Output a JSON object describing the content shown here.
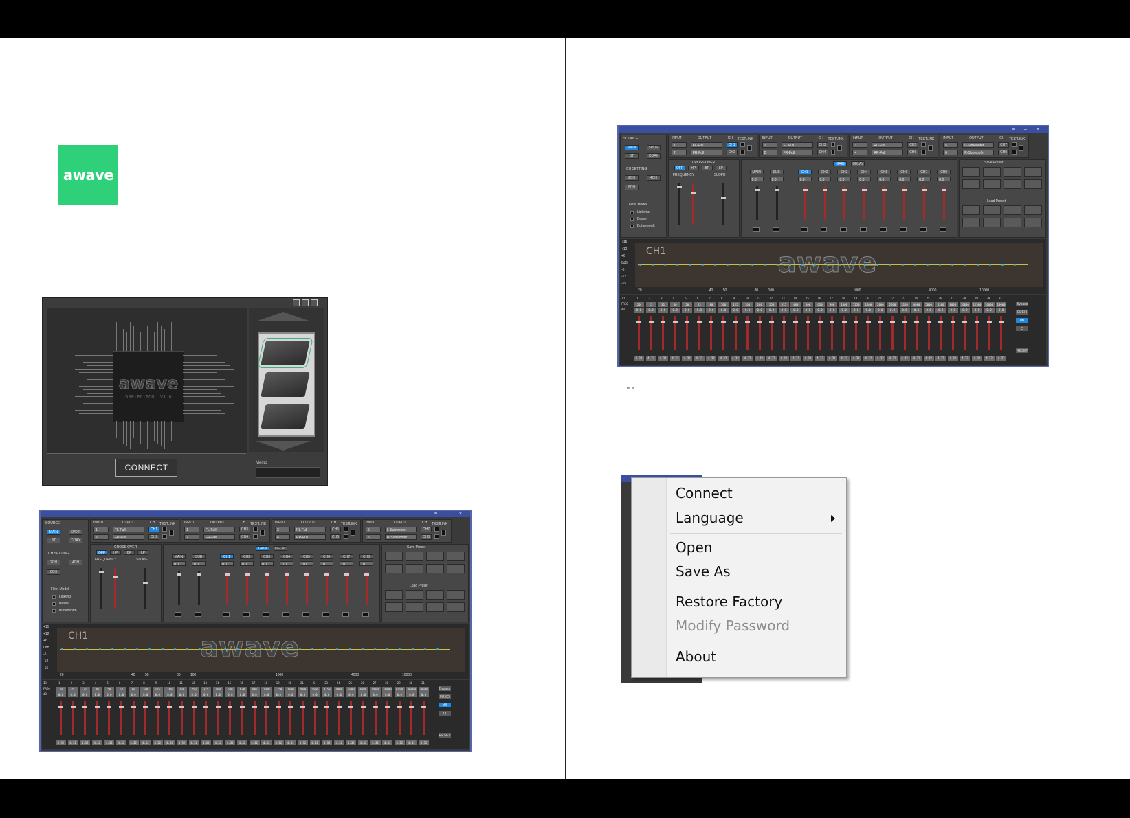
{
  "logo": {
    "text": "awave",
    "color": "#2fd07a"
  },
  "connect_window": {
    "chip_brand": "awave",
    "chip_model": "DSP-PC-TOOL V1.0",
    "connect_label": "CONNECT",
    "memo_label": "Memo"
  },
  "dsp_window": {
    "source_label": "SOURCE",
    "source_buttons": [
      "MAIN",
      "SPDIF",
      "BT",
      "COAX"
    ],
    "ch_setting_label": "CH SETTING",
    "ch_setting_buttons": [
      "2CH",
      "4CH",
      "8CH"
    ],
    "filter_model_label": "Filter Model",
    "filter_models": [
      "Linkwitz",
      "Bessel",
      "Butterworth"
    ],
    "input_label": "INPUT",
    "output_label": "OUTPUT",
    "ch_label": "CH",
    "test_label": "TEST",
    "link_label": "LINK",
    "routing": [
      {
        "in": [
          "1",
          "2"
        ],
        "out": [
          "FL-Full",
          "FR-Full"
        ],
        "ch": [
          "CH1",
          "CH2"
        ]
      },
      {
        "in": [
          "1",
          "2"
        ],
        "out": [
          "FL-Full",
          "FR-Full"
        ],
        "ch": [
          "CH3",
          "CH4"
        ]
      },
      {
        "in": [
          "3",
          "4"
        ],
        "out": [
          "RL-Full",
          "RR-Full"
        ],
        "ch": [
          "CH5",
          "CH6"
        ]
      },
      {
        "in": [
          "5",
          "6"
        ],
        "out": [
          "L-Subwoofer",
          "R-Subwoofer"
        ],
        "ch": [
          "CH7",
          "CH8"
        ]
      }
    ],
    "crossover_label": "CROSS OVER",
    "crossover_buttons": [
      "OFF",
      "HP",
      "BP",
      "LP"
    ],
    "frequency_label": "FREQUENCY",
    "slope_label": "SLOPE",
    "gain_label": "GAIN",
    "delay_label": "DELAY",
    "channel_buttons": [
      "MAIN",
      "SUB",
      "CH1",
      "CH2",
      "CH3",
      "CH4",
      "CH5",
      "CH6",
      "CH7",
      "CH8"
    ],
    "channel_values": [
      "0.0",
      "0.0",
      "0.0",
      "0.0",
      "0.0",
      "0.0",
      "0.0",
      "0.0",
      "0.0",
      "0.0"
    ],
    "save_preset_label": "Save Preset",
    "load_preset_label": "Load Preset",
    "graph_channel": "CH1",
    "graph_logo": "awave",
    "graph_y_ticks": [
      "+15",
      "+12",
      "+6",
      "0dB",
      "-6",
      "-12",
      "-15"
    ],
    "graph_x_ticks": [
      "20",
      "40",
      "50",
      "80",
      "100",
      "1000",
      "4000",
      "10000"
    ],
    "eq_row_labels": [
      "ID",
      "FREQ",
      "dB"
    ],
    "eq_bands": [
      "1",
      "2",
      "3",
      "4",
      "5",
      "6",
      "7",
      "8",
      "9",
      "10",
      "11",
      "12",
      "13",
      "14",
      "15",
      "16",
      "17",
      "18",
      "19",
      "20",
      "21",
      "22",
      "23",
      "24",
      "25",
      "26",
      "27",
      "28",
      "29",
      "30",
      "31"
    ],
    "eq_freqs": [
      "20",
      "25",
      "31",
      "40",
      "50",
      "63",
      "80",
      "100",
      "125",
      "160",
      "200",
      "250",
      "315",
      "400",
      "500",
      "630",
      "800",
      "1000",
      "1250",
      "1600",
      "2000",
      "2500",
      "3150",
      "4000",
      "5000",
      "6300",
      "8000",
      "10000",
      "12500",
      "16000",
      "20000"
    ],
    "eq_db": "0.0",
    "eq_q": "4.32",
    "side_buttons": [
      "Bypass",
      "FREQ",
      "dB",
      "Q",
      "RESET"
    ]
  },
  "caption": "\"     \"",
  "context_menu": {
    "items": [
      {
        "label": "Connect",
        "enabled": true,
        "submenu": false
      },
      {
        "label": "Language",
        "enabled": true,
        "submenu": true
      },
      {
        "label": "Open",
        "enabled": true,
        "submenu": false
      },
      {
        "label": "Save As",
        "enabled": true,
        "submenu": false
      },
      {
        "label": "Restore Factory",
        "enabled": true,
        "submenu": false
      },
      {
        "label": "Modify Password",
        "enabled": false,
        "submenu": false
      },
      {
        "label": "About",
        "enabled": true,
        "submenu": false
      }
    ]
  }
}
